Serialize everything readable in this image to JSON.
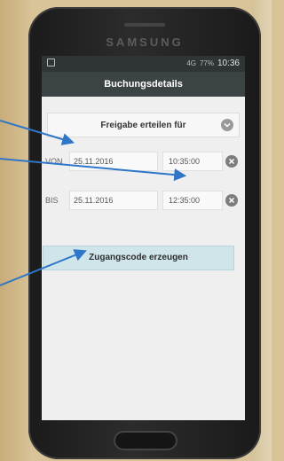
{
  "device": {
    "brand": "SAMSUNG"
  },
  "status_bar": {
    "network": "4G",
    "battery": "77%",
    "time": "10:36"
  },
  "header": {
    "title": "Buchungsdetails"
  },
  "dropdown": {
    "label": "Freigabe erteilen für"
  },
  "rows": {
    "von": {
      "label": "VON",
      "date": "25.11.2016",
      "time": "10:35:00"
    },
    "bis": {
      "label": "BIS",
      "date": "25.11.2016",
      "time": "12:35:00"
    }
  },
  "actions": {
    "generate": "Zugangscode erzeugen"
  },
  "annotation": {
    "arrow_color": "#2f76c8"
  }
}
